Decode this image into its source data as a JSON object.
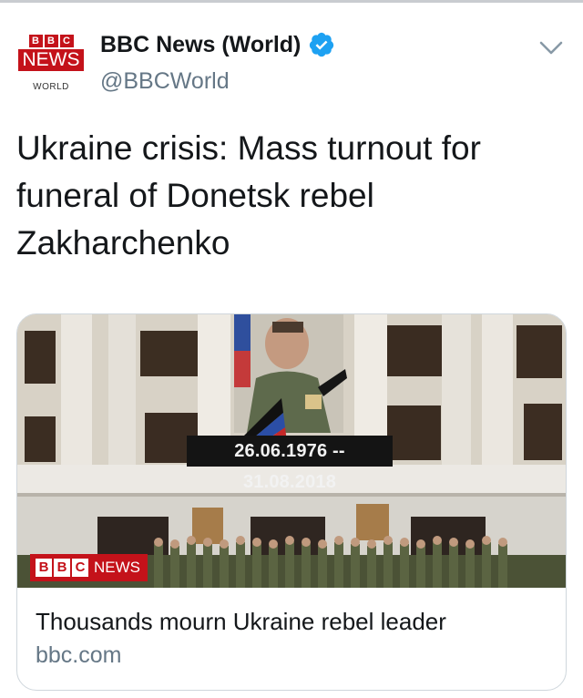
{
  "tweet": {
    "author": {
      "display_name": "BBC News (World)",
      "handle": "@BBCWorld",
      "verified": true,
      "avatar": {
        "blocks": [
          "B",
          "B",
          "C"
        ],
        "news": "NEWS",
        "world": "WORLD"
      }
    },
    "text": "Ukraine crisis: Mass turnout for funeral of Donetsk rebel Zakharchenko",
    "menu_icon": "chevron-down-icon"
  },
  "card": {
    "image": {
      "date_banner": "26.06.1976 -- 31.08.2018",
      "logo_blocks": [
        "B",
        "B",
        "C"
      ],
      "logo_news": "NEWS"
    },
    "title": "Thousands mourn Ukraine rebel leader",
    "domain": "bbc.com"
  },
  "colors": {
    "bbc_red": "#c4121a",
    "verified_blue": "#1da1f2",
    "secondary_text": "#657786"
  }
}
